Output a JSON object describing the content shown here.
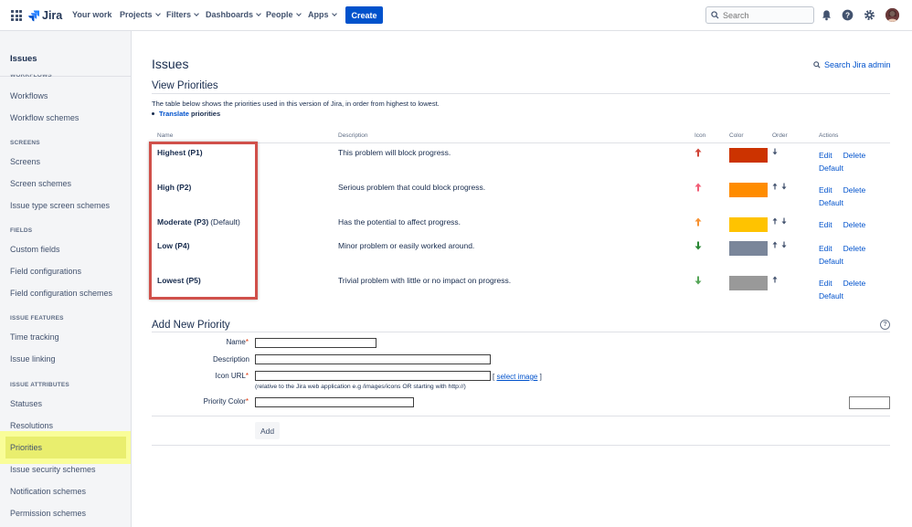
{
  "topnav": {
    "logo_text": "Jira",
    "items": [
      {
        "label": "Your work",
        "dropdown": false
      },
      {
        "label": "Projects",
        "dropdown": true
      },
      {
        "label": "Filters",
        "dropdown": true
      },
      {
        "label": "Dashboards",
        "dropdown": true
      },
      {
        "label": "People",
        "dropdown": true
      },
      {
        "label": "Apps",
        "dropdown": true
      }
    ],
    "create_label": "Create",
    "search_placeholder": "Search"
  },
  "sidebar": {
    "title": "Issues",
    "cut_section": "WORKFLOWS",
    "workflows": [
      "Workflows",
      "Workflow schemes"
    ],
    "screens_section": "SCREENS",
    "screens": [
      "Screens",
      "Screen schemes",
      "Issue type screen schemes"
    ],
    "fields_section": "FIELDS",
    "fields": [
      "Custom fields",
      "Field configurations",
      "Field configuration schemes"
    ],
    "features_section": "ISSUE FEATURES",
    "features": [
      "Time tracking",
      "Issue linking"
    ],
    "attributes_section": "ISSUE ATTRIBUTES",
    "attributes": [
      "Statuses",
      "Resolutions",
      "Priorities",
      "Issue security schemes",
      "Notification schemes",
      "Permission schemes"
    ],
    "active": "Priorities"
  },
  "main": {
    "page_title": "Issues",
    "search_admin": "Search Jira admin",
    "view_title": "View Priorities",
    "intro": "The table below shows the priorities used in this version of Jira, in order from highest to lowest.",
    "translate_link": "Translate",
    "translate_rest": "priorities",
    "columns": {
      "name": "Name",
      "description": "Description",
      "icon": "Icon",
      "color": "Color",
      "order": "Order",
      "actions": "Actions"
    },
    "priorities": [
      {
        "name": "Highest (P1)",
        "default_label": "",
        "description": "This problem will block progress.",
        "icon": "arrow-up-icon",
        "icon_color": "#d04437",
        "color": "#cc3300",
        "order": [
          "down"
        ],
        "actions": [
          "Edit",
          "Delete",
          "Default"
        ]
      },
      {
        "name": "High (P2)",
        "default_label": "",
        "description": "Serious problem that could block progress.",
        "icon": "arrow-up-icon",
        "icon_color": "#f15c75",
        "color": "#ff8c00",
        "order": [
          "up",
          "down"
        ],
        "actions": [
          "Edit",
          "Delete",
          "Default"
        ]
      },
      {
        "name": "Moderate (P3)",
        "default_label": "(Default)",
        "description": "Has the potential to affect progress.",
        "icon": "arrow-up-icon",
        "icon_color": "#f79232",
        "color": "#ffc300",
        "order": [
          "up",
          "down"
        ],
        "actions": [
          "Edit",
          "Delete"
        ]
      },
      {
        "name": "Low (P4)",
        "default_label": "",
        "description": "Minor problem or easily worked around.",
        "icon": "arrow-down-icon",
        "icon_color": "#2a8735",
        "color": "#7a869a",
        "order": [
          "up",
          "down"
        ],
        "actions": [
          "Edit",
          "Delete",
          "Default"
        ]
      },
      {
        "name": "Lowest (P5)",
        "default_label": "",
        "description": "Trivial problem with little or no impact on progress.",
        "icon": "arrow-down-icon",
        "icon_color": "#55a557",
        "color": "#999999",
        "order": [
          "up"
        ],
        "actions": [
          "Edit",
          "Delete",
          "Default"
        ]
      }
    ],
    "add_title": "Add New Priority",
    "form": {
      "name_label": "Name",
      "description_label": "Description",
      "icon_url_label": "Icon URL",
      "select_image_open": "[",
      "select_image": "select image",
      "select_image_close": "]",
      "icon_hint": "(relative to the Jira web application e.g /images/icons OR starting with http://)",
      "priority_color_label": "Priority Color",
      "add_button": "Add"
    }
  },
  "colors": {
    "accent": "#0052cc",
    "highlight": "#d0504a"
  }
}
